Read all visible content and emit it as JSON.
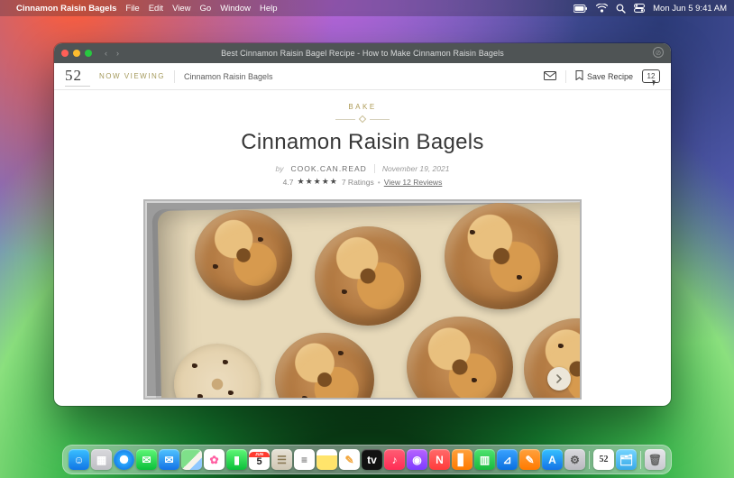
{
  "menubar": {
    "app_name": "Cinnamon Raisin Bagels",
    "items": [
      "File",
      "Edit",
      "View",
      "Go",
      "Window",
      "Help"
    ],
    "clock": "Mon Jun 5 9:41 AM"
  },
  "window": {
    "title": "Best Cinnamon Raisin Bagel Recipe - How to Make Cinnamon Raisin Bagels",
    "brand": "52",
    "now_viewing_label": "NOW VIEWING",
    "now_viewing_title": "Cinnamon Raisin Bagels",
    "save_label": "Save Recipe",
    "comment_count": "12"
  },
  "recipe": {
    "category": "BAKE",
    "title": "Cinnamon Raisin Bagels",
    "by_label": "by",
    "author": "COOK.CAN.READ",
    "date": "November 19, 2021",
    "rating_value": "4.7",
    "stars": "★★★★★",
    "ratings_label": "7 Ratings",
    "reviews_link": "View 12 Reviews"
  },
  "dock": {
    "items": [
      {
        "name": "finder",
        "bg": "linear-gradient(#3ac0ff,#1176e6)",
        "glyph": "☺"
      },
      {
        "name": "launchpad",
        "bg": "linear-gradient(#d8d8dc,#bfbfc5)",
        "glyph": "▦"
      },
      {
        "name": "safari",
        "bg": "radial-gradient(circle,#fff 28%,#2aa7ff 30%,#0763d3)",
        "glyph": "",
        "round": true
      },
      {
        "name": "messages",
        "bg": "linear-gradient(#5ff777,#0bbf3a)",
        "glyph": "✉"
      },
      {
        "name": "mail",
        "bg": "linear-gradient(#4fc3ff,#1473e6)",
        "glyph": "✉"
      },
      {
        "name": "maps",
        "bg": "linear-gradient(135deg,#7fe08a 0 50%,#f6f3ea 50% 70%,#8fc8ff 70%)",
        "glyph": ""
      },
      {
        "name": "photos",
        "bg": "#fff",
        "glyph": "✿",
        "color": "#ff5fa2"
      },
      {
        "name": "facetime",
        "bg": "linear-gradient(#5ff777,#0bbf3a)",
        "glyph": "▮"
      },
      {
        "name": "calendar",
        "bg": "#fff",
        "glyph": "5",
        "color": "#222",
        "top": "JUN"
      },
      {
        "name": "contacts",
        "bg": "linear-gradient(#e7e2d6,#cfc7b4)",
        "glyph": "☰",
        "color": "#8a7a55"
      },
      {
        "name": "reminders",
        "bg": "#fff",
        "glyph": "≡",
        "color": "#555"
      },
      {
        "name": "notes",
        "bg": "linear-gradient(#fff 0 30%,#ffe46b 30%)",
        "glyph": "",
        "color": "#555"
      },
      {
        "name": "freeform",
        "bg": "#fff",
        "glyph": "✎",
        "color": "#f2a63c"
      },
      {
        "name": "tv",
        "bg": "#111",
        "glyph": "tv",
        "color": "#fff"
      },
      {
        "name": "music",
        "bg": "linear-gradient(#ff5d74,#ff2d55)",
        "glyph": "♪"
      },
      {
        "name": "podcasts",
        "bg": "linear-gradient(#b863ff,#7d3cff)",
        "glyph": "◉"
      },
      {
        "name": "news",
        "bg": "linear-gradient(#ff6a6a,#ff3b3b)",
        "glyph": "N"
      },
      {
        "name": "books",
        "bg": "linear-gradient(#ffa13d,#ff7a00)",
        "glyph": "▋"
      },
      {
        "name": "numbers",
        "bg": "linear-gradient(#4fe36f,#18b93e)",
        "glyph": "▥"
      },
      {
        "name": "keynote",
        "bg": "linear-gradient(#3aa3ff,#0a6fe0)",
        "glyph": "⊿"
      },
      {
        "name": "pages",
        "bg": "linear-gradient(#ffa13d,#ff7a00)",
        "glyph": "✎"
      },
      {
        "name": "appstore",
        "bg": "linear-gradient(#35c1ff,#1473e6)",
        "glyph": "A"
      },
      {
        "name": "settings",
        "bg": "linear-gradient(#d9d9de,#b9b9bf)",
        "glyph": "⚙",
        "color": "#555"
      },
      {
        "name": "food52",
        "bg": "#fff",
        "glyph": "52",
        "color": "#333",
        "sep_before": true
      },
      {
        "name": "desktop-folder",
        "bg": "linear-gradient(#74d5ff,#39a9e8)",
        "glyph": "🗂"
      },
      {
        "name": "trash",
        "bg": "linear-gradient(#e6e6ea,#c9c9cf)",
        "glyph": "🗑",
        "color": "#666",
        "sep_before": true
      }
    ]
  }
}
